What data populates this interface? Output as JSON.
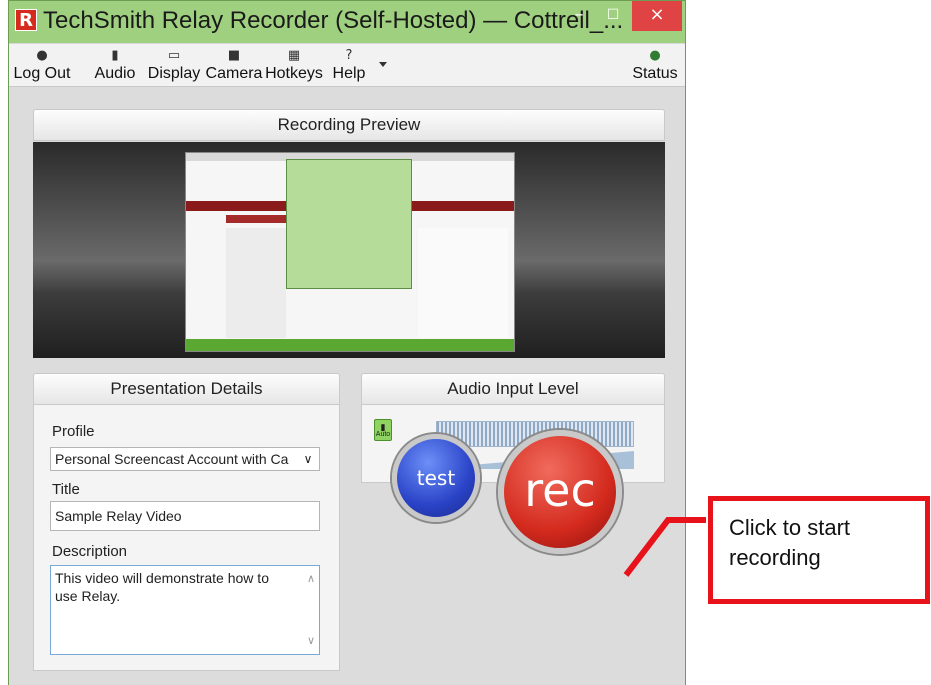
{
  "window": {
    "logo_letter": "R",
    "title": "TechSmith Relay Recorder (Self-Hosted) — Cottrell_...",
    "min_glyph": "–",
    "max_glyph": "☐",
    "close_glyph": "×"
  },
  "menu": {
    "items": [
      {
        "label": "Log Out",
        "icon": "lock-icon",
        "glyph": "🔒"
      },
      {
        "label": "Audio",
        "icon": "microphone-icon",
        "glyph": "🎙"
      },
      {
        "label": "Display",
        "icon": "monitor-icon",
        "glyph": "🖵"
      },
      {
        "label": "Camera",
        "icon": "camera-icon",
        "glyph": "■"
      },
      {
        "label": "Hotkeys",
        "icon": "keyboard-icon",
        "glyph": "▦"
      },
      {
        "label": "Help",
        "icon": "question-icon",
        "glyph": "?"
      }
    ],
    "status": {
      "label": "Status",
      "icon": "status-globe-icon",
      "glyph": "●"
    }
  },
  "preview": {
    "heading": "Recording Preview"
  },
  "details": {
    "heading": "Presentation Details",
    "profile_label": "Profile",
    "profile_value": "Personal Screencast Account with Ca",
    "title_label": "Title",
    "title_value": "Sample Relay Video",
    "description_label": "Description",
    "description_value": "This video will demonstrate how to use Relay."
  },
  "audio": {
    "heading": "Audio Input Level",
    "mic_label": "Auto",
    "level": 0.8
  },
  "buttons": {
    "test_label": "test",
    "rec_label": "rec"
  },
  "callout": {
    "text": "Click to start\nrecording"
  },
  "colors": {
    "window_frame": "#9fd07f",
    "close_red": "#e04343",
    "callout_red": "#e8121b",
    "rec_red": "#d32a1d",
    "test_blue": "#2a43c7"
  }
}
